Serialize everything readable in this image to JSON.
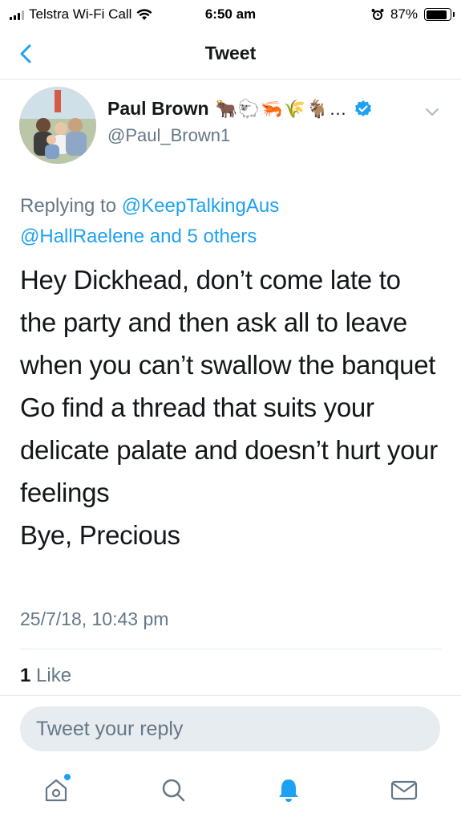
{
  "status_bar": {
    "carrier": "Telstra Wi-Fi Call",
    "time": "6:50 am",
    "battery": "87%",
    "battery_level": 0.87
  },
  "nav": {
    "title": "Tweet"
  },
  "tweet": {
    "author_name": "Paul Brown",
    "author_emojis": "🐂🐑🦐🌾🐐…",
    "handle": "@Paul_Brown1",
    "reply_label": "Replying to ",
    "reply_mention_1": "@KeepTalkingAus",
    "reply_mention_2": "@HallRaelene",
    "reply_and": " and ",
    "reply_others": "5 others",
    "text": "Hey Dickhead, don’t come late to the party and then ask all to leave when you can’t swallow the banquet\nGo find a thread that suits your delicate palate and doesn’t hurt your feelings\nBye, Precious",
    "timestamp": "25/7/18, 10:43 pm",
    "like_count": "1",
    "like_label": " Like"
  },
  "composer": {
    "placeholder": "Tweet your reply"
  },
  "colors": {
    "accent": "#1da1f2",
    "secondary_text": "#657786",
    "divider": "#e1e8ed",
    "reply_box_bg": "#e6ecf0"
  },
  "icons": [
    "back-chevron-icon",
    "verified-badge-icon",
    "caret-down-icon",
    "home-icon",
    "search-icon",
    "notifications-bell-icon",
    "messages-envelope-icon"
  ]
}
